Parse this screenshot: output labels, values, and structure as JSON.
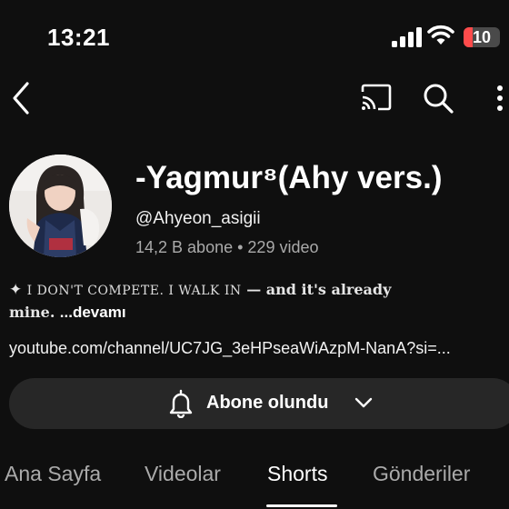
{
  "status_bar": {
    "time": "13:21",
    "battery": "10"
  },
  "channel": {
    "name": "-Yagmur⁸(Ahy vers.)",
    "handle": "@Ahyeon_asigii",
    "subscribers": "14,2 B abone",
    "separator": " • ",
    "videos": "229 video",
    "description_line1_icon": "✦",
    "description_line1_smallcaps": "I DON'T COMPETE. I WALK IN",
    "description_line1_rest": " — and it's  already",
    "description_line2": "mine.",
    "description_more": "...devamı",
    "link": "youtube.com/channel/UC7JG_3eHPseaWiAzpM-NanA?si=..."
  },
  "subscribe": {
    "label": "Abone olundu"
  },
  "tabs": [
    {
      "label": "Ana Sayfa",
      "active": false
    },
    {
      "label": "Videolar",
      "active": false
    },
    {
      "label": "Shorts",
      "active": true
    },
    {
      "label": "Gönderiler",
      "active": false
    }
  ],
  "icons": {
    "back": "back-icon",
    "cast": "cast-icon",
    "search": "search-icon",
    "more": "more-vertical-icon",
    "bell": "bell-icon",
    "chevron": "chevron-down-icon"
  },
  "colors": {
    "background": "#0f0f0f",
    "button_bg": "#272727",
    "muted_text": "#aaaaaa",
    "battery_low": "#ff4b4b"
  }
}
